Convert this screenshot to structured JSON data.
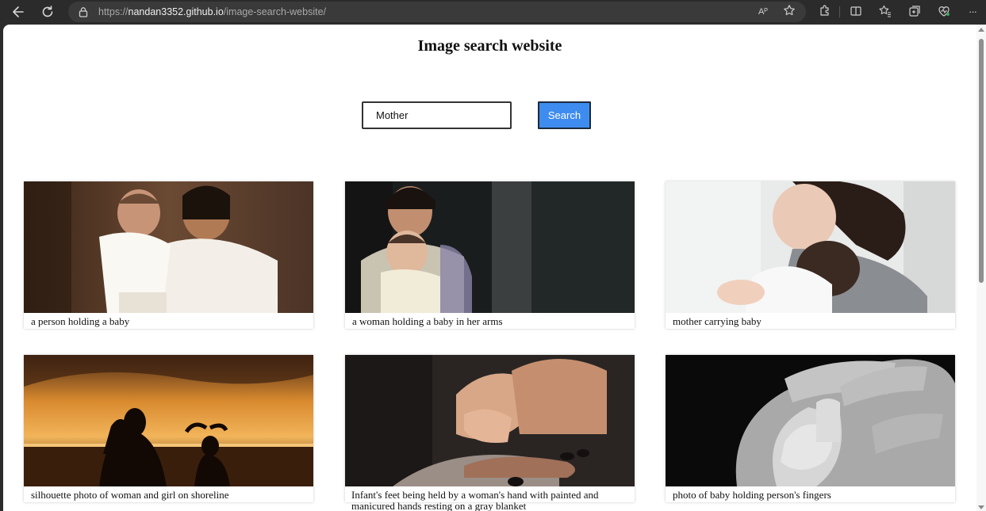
{
  "browser": {
    "url_scheme": "https://",
    "url_host": "nandan3352.github.io",
    "url_path": "/image-search-website/",
    "read_aloud_label": "Aᴾ",
    "back_icon": "back-arrow-icon",
    "refresh_icon": "refresh-icon",
    "lock_icon": "lock-icon",
    "more_label": "···"
  },
  "page": {
    "title": "Image search website"
  },
  "search": {
    "value": "Mother",
    "button_label": "Search",
    "button_color": "#3f8cf0"
  },
  "results": [
    {
      "caption": "a person holding a baby"
    },
    {
      "caption": "a woman holding a baby in her arms"
    },
    {
      "caption": "mother carrying baby"
    },
    {
      "caption": "silhouette photo of woman and girl on shoreline"
    },
    {
      "caption": "Infant's feet being held by a woman's hand with painted and manicured hands resting on a gray blanket"
    },
    {
      "caption": "photo of baby holding person's fingers"
    }
  ]
}
